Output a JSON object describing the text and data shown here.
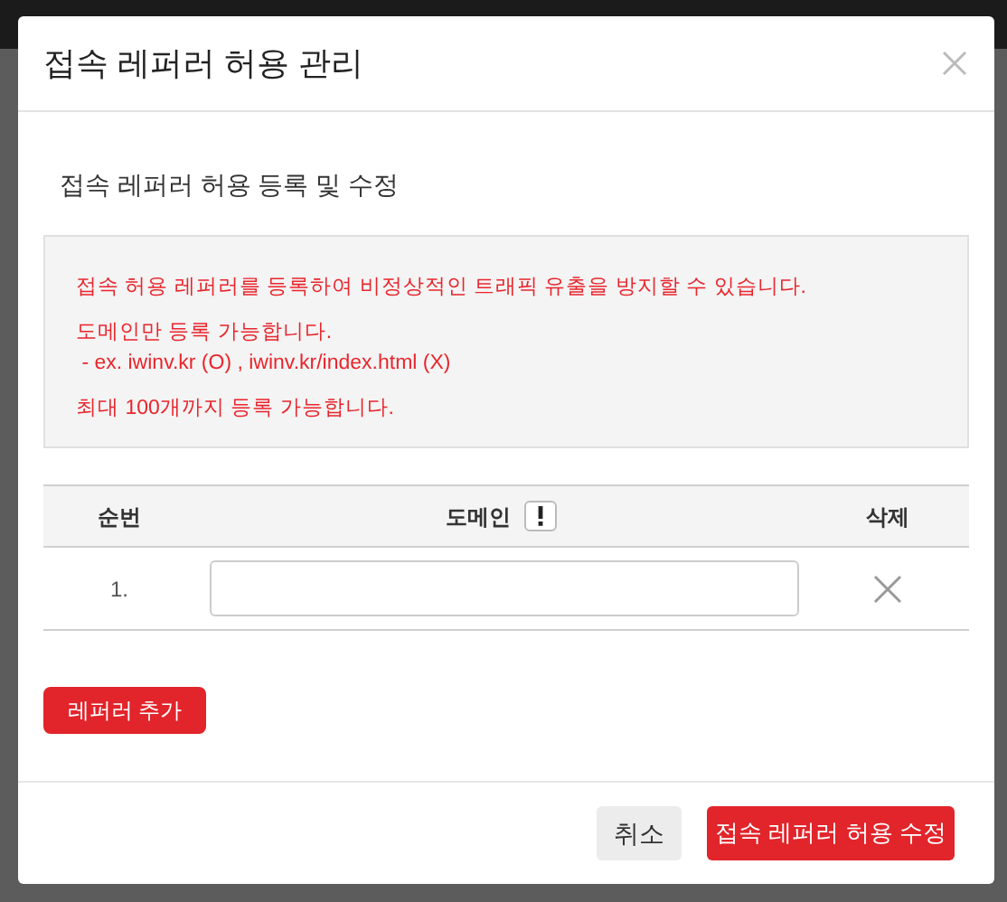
{
  "dialog": {
    "title": "접속 레퍼러 허용 관리",
    "section_title": "접속 레퍼러 허용 등록 및 수정",
    "notice": [
      "접속 허용 레퍼러를 등록하여 비정상적인 트래픽 유출을 방지할 수 있습니다.",
      "도메인만 등록 가능합니다.\n - ex. iwinv.kr (O) , iwinv.kr/index.html (X)",
      "최대 100개까지 등록 가능합니다."
    ],
    "table": {
      "columns": [
        "순번",
        "도메인",
        "삭제"
      ],
      "rows": [
        {
          "number": "1.",
          "value": ""
        }
      ]
    },
    "add_button": "레퍼러 추가",
    "buttons": [
      {
        "label": "취소",
        "kind": "secondary"
      },
      {
        "label": "접속 레퍼러 허용 수정",
        "kind": "primary"
      }
    ]
  }
}
